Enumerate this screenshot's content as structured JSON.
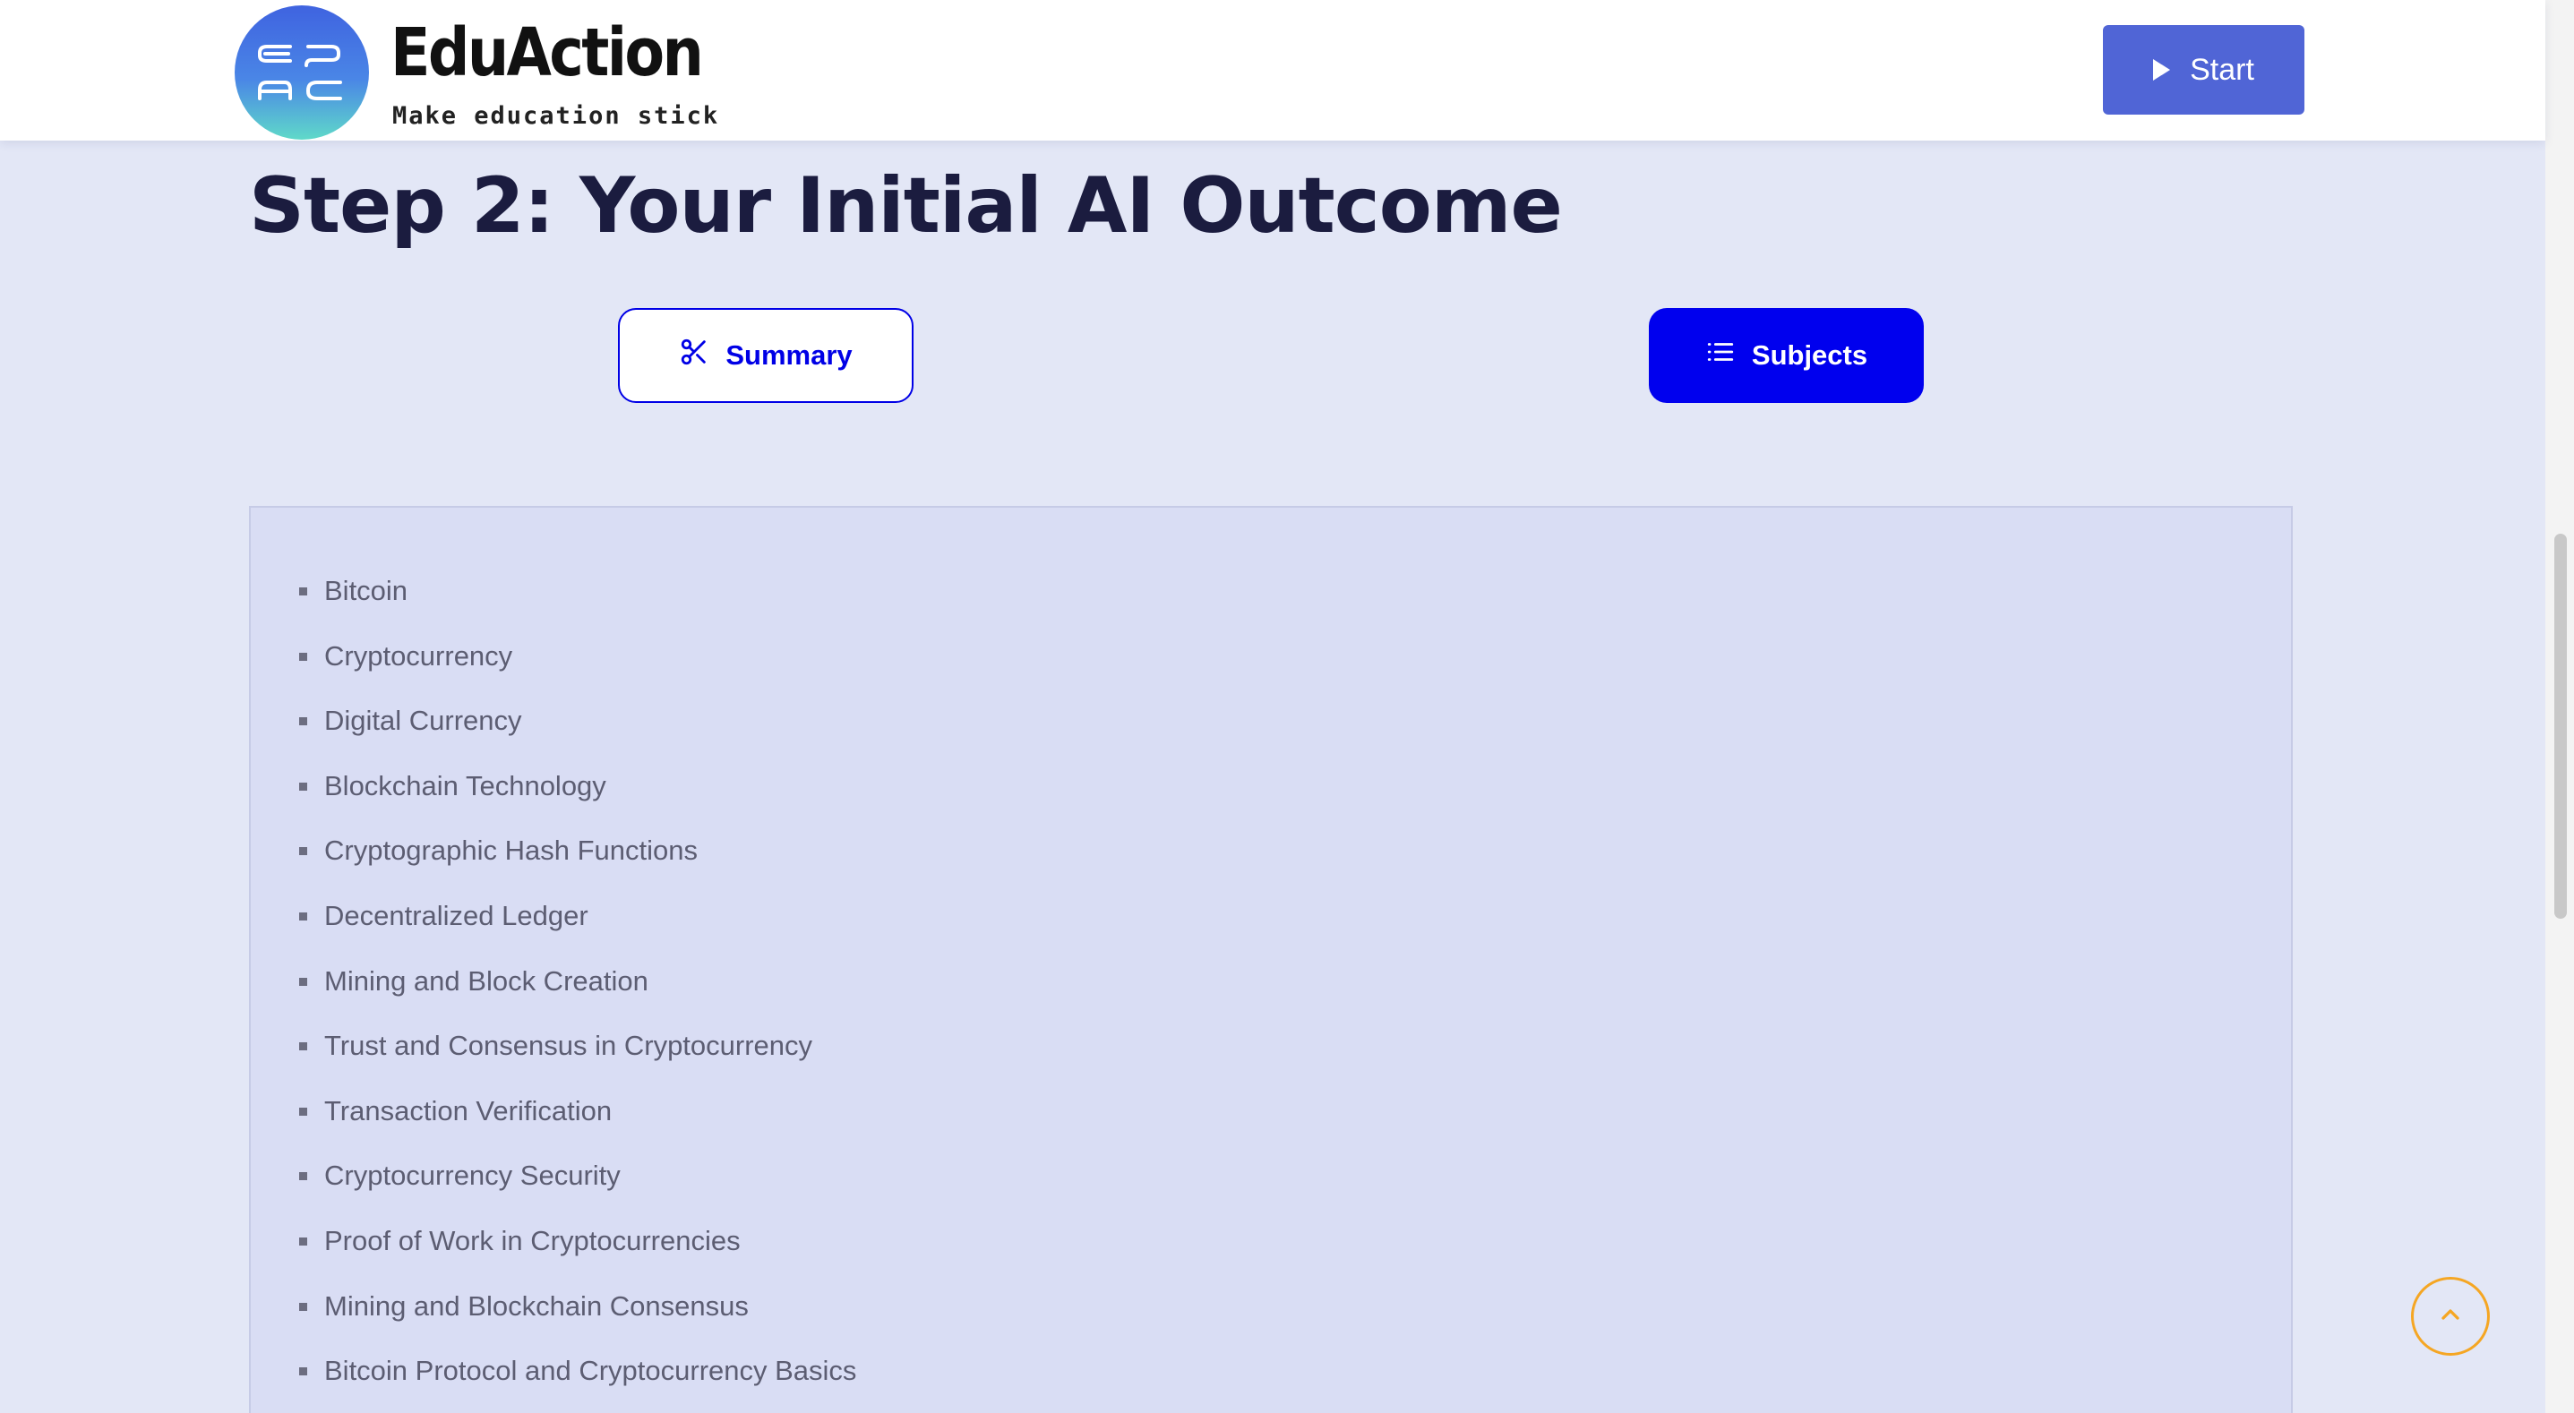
{
  "header": {
    "brand_name": "EduAction",
    "tagline": "Make education stick",
    "start_label": "Start"
  },
  "main": {
    "title": "Step 2: Your Initial AI Outcome",
    "tabs": [
      {
        "label": "Summary",
        "icon": "scissors-icon",
        "active": false
      },
      {
        "label": "Subjects",
        "icon": "list-icon",
        "active": true
      }
    ],
    "subjects": [
      "Bitcoin",
      "Cryptocurrency",
      "Digital Currency",
      "Blockchain Technology",
      "Cryptographic Hash Functions",
      "Decentralized Ledger",
      "Mining and Block Creation",
      "Trust and Consensus in Cryptocurrency",
      "Transaction Verification",
      "Cryptocurrency Security",
      "Proof of Work in Cryptocurrencies",
      "Mining and Blockchain Consensus",
      "Bitcoin Protocol and Cryptocurrency Basics"
    ]
  },
  "colors": {
    "accent_blue": "#0000ee",
    "start_button": "#5065d6",
    "background": "#e3e7f6",
    "panel": "#d9ddf4",
    "back_to_top_ring": "#f5a623"
  }
}
